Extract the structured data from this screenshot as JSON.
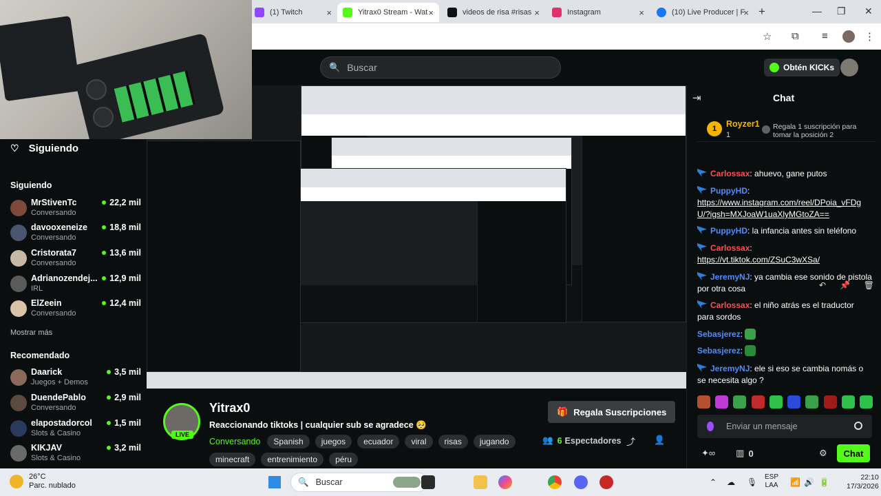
{
  "browser": {
    "tabs": [
      {
        "label": "(1) Twitch",
        "color": "#9146ff"
      },
      {
        "label": "Yitrax0 Stream - Wat",
        "color": "#53fc18"
      },
      {
        "label": "videos de risa #risas",
        "color": "#111111"
      },
      {
        "label": "Instagram",
        "color": "#e1306c"
      },
      {
        "label": "(10) Live Producer | F",
        "color": "#1877f2"
      }
    ],
    "new_tab": "+",
    "minimize": "—",
    "maximize": "❐",
    "close": "✕"
  },
  "header": {
    "search_placeholder": "Buscar",
    "kicks_label": "Obtén KICKs"
  },
  "sidebar": {
    "following_header": "Siguiendo",
    "following_title": "Siguiendo",
    "following": [
      {
        "name": "MrStivenTc",
        "category": "Conversando",
        "viewers": "22,2 mil",
        "avatar": "#7b4a3a"
      },
      {
        "name": "davooxeneize",
        "category": "Conversando",
        "viewers": "18,8 mil",
        "avatar": "#4a5670"
      },
      {
        "name": "Cristorata7",
        "category": "Conversando",
        "viewers": "13,6 mil",
        "avatar": "#c8b9a6"
      },
      {
        "name": "Adrianozendej...",
        "category": "IRL",
        "viewers": "12,9 mil",
        "avatar": "#5a5a5a"
      },
      {
        "name": "ElZeein",
        "category": "Conversando",
        "viewers": "12,4 mil",
        "avatar": "#d9c2a8"
      }
    ],
    "show_more": "Mostrar más",
    "recommended_title": "Recomendado",
    "recommended": [
      {
        "name": "Daarick",
        "category": "Juegos + Demos",
        "viewers": "3,5 mil",
        "avatar": "#8a6a5a"
      },
      {
        "name": "DuendePablo",
        "category": "Conversando",
        "viewers": "2,9 mil",
        "avatar": "#5a4a40"
      },
      {
        "name": "elapostadorcol",
        "category": "Slots & Casino",
        "viewers": "1,5 mil",
        "avatar": "#2a3a5a"
      },
      {
        "name": "KIKJAV",
        "category": "Slots & Casino",
        "viewers": "3,2 mil",
        "avatar": "#6a6a6a"
      }
    ]
  },
  "stream": {
    "streamer": "Yitrax0",
    "live_badge": "LIVE",
    "title": "Reaccionando tiktoks | cualquier sub se agradece 🥺",
    "category": "Conversando",
    "tags": [
      "Spanish",
      "juegos",
      "ecuador",
      "viral",
      "risas",
      "jugando",
      "minecraft",
      "entrenimiento",
      "péru"
    ],
    "gift_button": "Regala Suscripciones",
    "viewers_count": "6",
    "viewers_label": "Espectadores"
  },
  "chat": {
    "title": "Chat",
    "pinned": {
      "user": "Royzer1",
      "rank": "1",
      "count": "1",
      "message": "Regala 1 suscripción para tomar la posición 2"
    },
    "messages": [
      {
        "user": "Carlossax",
        "color": "#ff4d4d",
        "badge": false,
        "text": ": ahuevo, gane putos",
        "link": ""
      },
      {
        "user": "PuppyHD",
        "color": "#4d8dff",
        "badge": true,
        "text": ":",
        "link": "https://www.instagram.com/reel/DPoia_vFDgU/?igsh=MXJoaW1uaXlyMGtoZA=="
      },
      {
        "user": "PuppyHD",
        "color": "#4d8dff",
        "badge": true,
        "text": ": la infancia antes sin teléfono",
        "link": ""
      },
      {
        "user": "Carlossax",
        "color": "#ff4d4d",
        "badge": true,
        "text": ":",
        "link": "https://vt.tiktok.com/ZSuC3wXSa/"
      },
      {
        "user": "JeremyNJ",
        "color": "#4d8dff",
        "badge": true,
        "text": ": ya cambia ese sonido de pistola por otra cosa",
        "link": ""
      },
      {
        "user": "Carlossax",
        "color": "#ff4d4d",
        "badge": true,
        "text": ": el niño atrás es el traductor para sordos",
        "link": ""
      },
      {
        "user": "Sebasjerez",
        "color": "#4d8dff",
        "badge": false,
        "text": ":",
        "link": ""
      },
      {
        "user": "Sebasjerez",
        "color": "#4d8dff",
        "badge": false,
        "text": ":",
        "link": ""
      },
      {
        "user": "JeremyNJ",
        "color": "#4d8dff",
        "badge": true,
        "text": ": ele si eso se cambia nomás o se necesita algo ?",
        "link": ""
      }
    ],
    "input_placeholder": "Enviar un mensaje",
    "kicks_count": "0",
    "send_label": "Chat",
    "emotes": [
      "#b5502e",
      "#c03ad8",
      "#3aa14a",
      "#c02a2a",
      "#2ec24a",
      "#2a4ad8",
      "#3aa14a",
      "#a01a1a",
      "#2ec24a",
      "#2ec24a"
    ]
  },
  "taskbar": {
    "weather_temp": "26°C",
    "weather_desc": "Parc. nublado",
    "search_label": "Buscar",
    "lang_line1": "ESP",
    "lang_line2": "LAA",
    "time": "22:10",
    "date": "17/3/2026"
  },
  "colors": {
    "accent": "#53fc18",
    "background": "#0b0e0f"
  }
}
